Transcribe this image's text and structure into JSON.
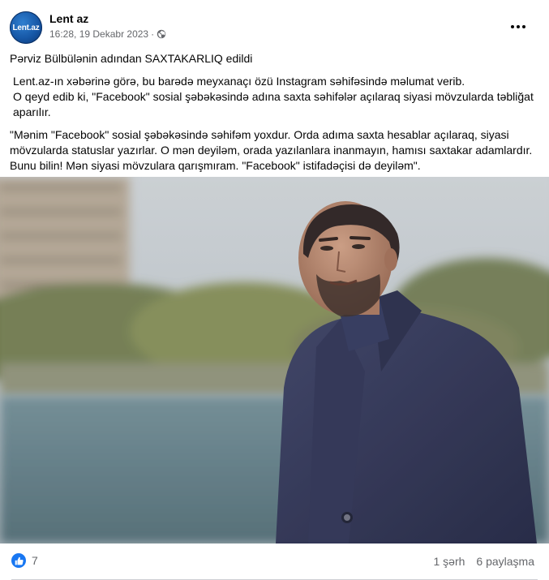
{
  "header": {
    "avatar_text": "Lent.az",
    "page_name": "Lent az",
    "timestamp": "16:28, 19 Dekabr 2023",
    "separator": "·",
    "privacy_icon": "globe-icon",
    "more_icon": "more-options-icon"
  },
  "post": {
    "headline": "Pərviz Bülbülənin adından SAXTAKARLIQ edildi",
    "para1": "Lent.az-ın xəbərinə görə, bu barədə meyxanaçı özü  Instagram  səhifəsində məlumat verib.\n O qeyd edib ki, \"Facebook\" sosial şəbəkəsində adına  saxta səhifələr açılaraq siyasi mövzularda  təbliğat aparılır.",
    "para2": "\"Mənim \"Facebook\" sosial şəbəkəsində səhifəm yoxdur.  Orda adıma saxta hesablar açılaraq, siyasi mövzularda statuslar yazırlar. O mən deyiləm, orada yazılanlara inanmayın, hamısı saxtakar adamlardır. Bunu bilin! Mən siyasi mövzulara qarışmıram. \"Facebook\"  istifadəçisi də deyiləm\"."
  },
  "footer": {
    "reaction_icon": "like-icon",
    "reaction_count": "7",
    "comments": "1 şərh",
    "shares": "6 paylaşma"
  },
  "colors": {
    "facebook_blue": "#1877f2",
    "secondary_text": "#65676b"
  }
}
